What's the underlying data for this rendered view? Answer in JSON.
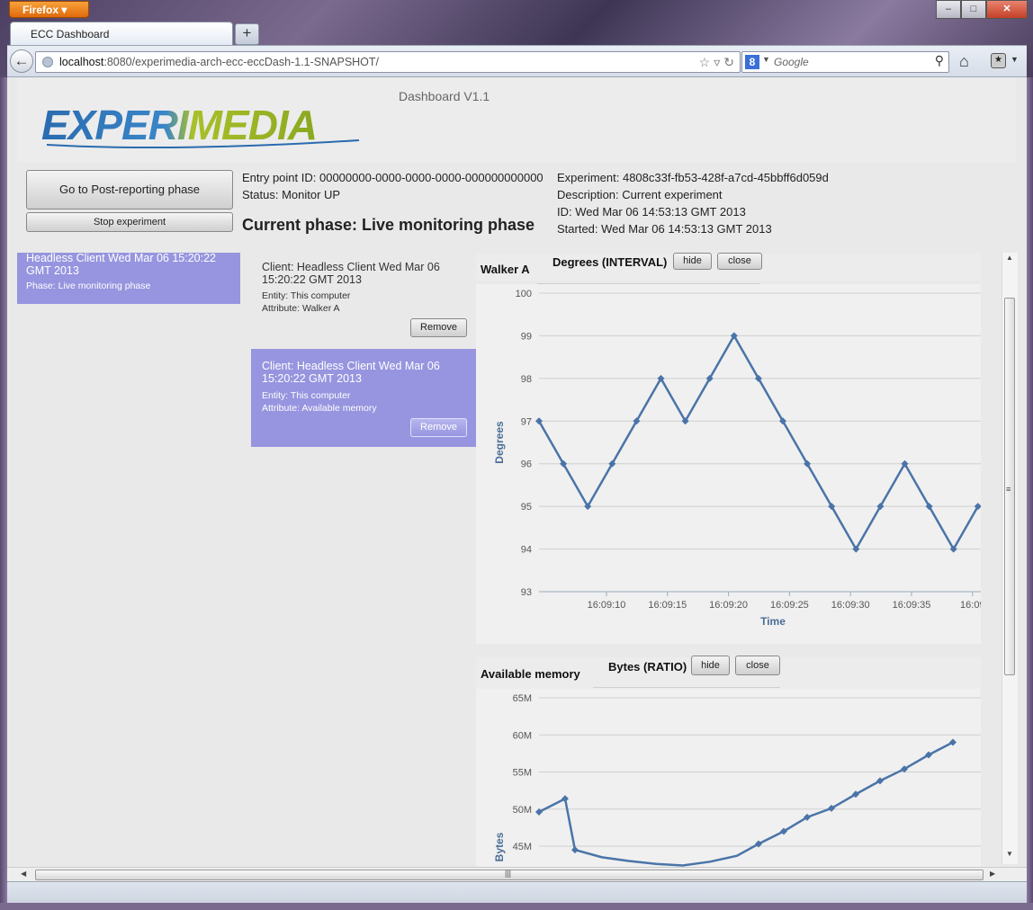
{
  "browser": {
    "menu_button": "Firefox",
    "window_controls": [
      "–",
      "□",
      "✕"
    ],
    "tab_title": "ECC Dashboard",
    "new_tab": "+",
    "url_host": "localhost",
    "url_rest": ":8080/experimedia-arch-ecc-eccDash-1.1-SNAPSHOT/",
    "search_engine": "8",
    "search_placeholder": "Google"
  },
  "header": {
    "logo_text": "EXPERIMEDIA",
    "dashboard_title": "Dashboard V1.1"
  },
  "controls": {
    "post_reporting_button": "Go to Post-reporting phase",
    "stop_button": "Stop experiment"
  },
  "status": {
    "entry_point": "Entry point ID: 00000000-0000-0000-0000-000000000000",
    "monitor_status": "Status: Monitor UP",
    "current_phase": "Current phase: Live monitoring phase"
  },
  "experiment": {
    "id_line": "Experiment: 4808c33f-fb53-428f-a7cd-45bbff6d059d",
    "description": "Description: Current experiment",
    "id_date": "ID: Wed Mar 06 14:53:13 GMT 2013",
    "started": "Started: Wed Mar 06 14:53:13 GMT 2013"
  },
  "client_card": {
    "title": "Headless Client Wed Mar 06 15:20:22 GMT 2013",
    "phase": "Phase: Live monitoring phase"
  },
  "metric_cards": [
    {
      "client": "Client: Headless Client Wed Mar 06 15:20:22 GMT 2013",
      "entity": "Entity: This computer",
      "attribute": "Attribute: Walker A",
      "remove": "Remove"
    },
    {
      "client": "Client: Headless Client Wed Mar 06 15:20:22 GMT 2013",
      "entity": "Entity: This computer",
      "attribute": "Attribute: Available memory",
      "remove": "Remove"
    }
  ],
  "charts_header": [
    {
      "name": "Walker A",
      "unit": "Degrees (INTERVAL)",
      "hide": "hide",
      "close": "close"
    },
    {
      "name": "Available memory",
      "unit": "Bytes (RATIO)",
      "hide": "hide",
      "close": "close"
    }
  ],
  "colors": {
    "accent_card": "#9795df",
    "series_line": "#4a74a8"
  },
  "chart_data": [
    {
      "type": "line",
      "title": "",
      "xlabel": "Time",
      "ylabel": "Degrees",
      "ylim": [
        93,
        100
      ],
      "yticks": [
        "93",
        "94",
        "95",
        "96",
        "97",
        "98",
        "99",
        "100"
      ],
      "xticks": [
        "16:09:10",
        "16:09:15",
        "16:09:20",
        "16:09:25",
        "16:09:30",
        "16:09:35",
        "16:09"
      ],
      "x": [
        "16:09:06",
        "16:09:07",
        "16:09:08",
        "16:09:09",
        "16:09:10",
        "16:09:11",
        "16:09:12",
        "16:09:13",
        "16:09:14",
        "16:09:15",
        "16:09:16",
        "16:09:17",
        "16:09:18",
        "16:09:19",
        "16:09:20",
        "16:09:21",
        "16:09:22",
        "16:09:23",
        "16:09:24",
        "16:09:25"
      ],
      "series": [
        {
          "values": [
            97,
            96,
            95,
            96,
            97,
            98,
            97,
            98,
            99,
            98,
            97,
            96,
            95,
            94,
            95,
            96,
            95,
            94,
            95,
            95
          ]
        }
      ],
      "grid": true
    },
    {
      "type": "line",
      "title": "",
      "xlabel": "",
      "ylabel": "Bytes",
      "ylim": [
        45,
        65
      ],
      "yticks": [
        "45M",
        "50M",
        "55M",
        "60M",
        "65M"
      ],
      "series": [
        {
          "values": [
            49.6,
            51.4,
            44.5,
            43.5,
            43.0,
            42.6,
            42.4,
            42.9,
            43.7,
            45.3,
            47.0,
            48.9,
            50.1,
            52.0,
            53.8,
            55.4,
            57.3,
            59.0
          ]
        }
      ],
      "grid": true
    }
  ]
}
